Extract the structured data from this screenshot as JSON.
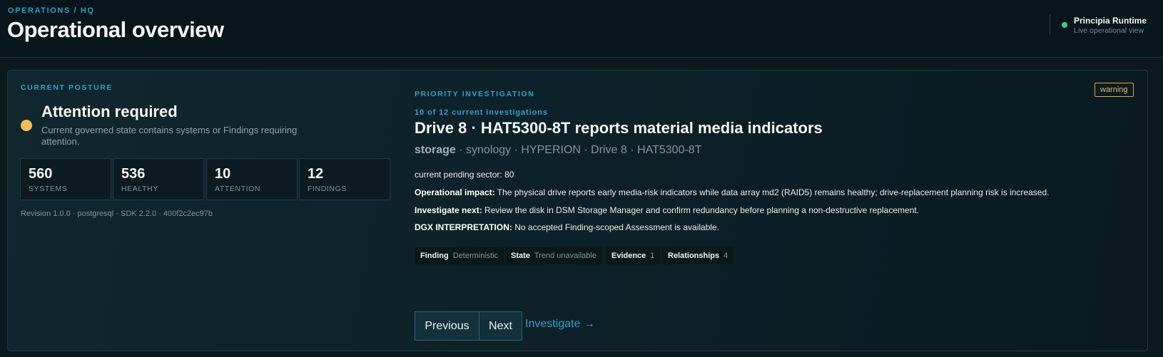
{
  "header": {
    "breadcrumb": "OPERATIONS / HQ",
    "title": "Operational overview",
    "runtime": {
      "name": "Principia Runtime",
      "subtitle": "Live operational view",
      "status_color": "#2fd58a"
    }
  },
  "posture": {
    "label": "CURRENT POSTURE",
    "status_color": "#f4bd52",
    "title": "Attention required",
    "description": "Current governed state contains systems or Findings requiring attention.",
    "stats": [
      {
        "value": "560",
        "label": "SYSTEMS"
      },
      {
        "value": "536",
        "label": "HEALTHY"
      },
      {
        "value": "10",
        "label": "ATTENTION"
      },
      {
        "value": "12",
        "label": "FINDINGS"
      }
    ],
    "revision": "Revision 1.0.0 · postgresql · SDK 2.2.0 · 400f2c2ec97b"
  },
  "investigation": {
    "label": "PRIORITY INVESTIGATION",
    "severity": "warning",
    "count": "10 of 12 current investigations",
    "title": "Drive 8 · HAT5300-8T reports material media indicators",
    "subtitle_category": "storage",
    "subtitle_rest": " · synology · HYPERION · Drive 8 · HAT5300-8T",
    "metric": "current pending sector: 80",
    "impact_label": "Operational impact:",
    "impact_text": " The physical drive reports early media-risk indicators while data array md2 (RAID5) remains healthy; drive-replacement planning risk is increased.",
    "next_label": "Investigate next:",
    "next_text": " Review the disk in DSM Storage Manager and confirm redundancy before planning a non-destructive replacement.",
    "dgx_label": "DGX INTERPRETATION:",
    "dgx_text": " No accepted Finding-scoped Assessment is available.",
    "chips": [
      {
        "key": "Finding",
        "value": "Deterministic"
      },
      {
        "key": "State",
        "value": "Trend unavailable"
      },
      {
        "key": "Evidence",
        "value": "1"
      },
      {
        "key": "Relationships",
        "value": "4"
      }
    ],
    "buttons": {
      "previous": "Previous",
      "next": "Next",
      "investigate": "Investigate →"
    }
  }
}
